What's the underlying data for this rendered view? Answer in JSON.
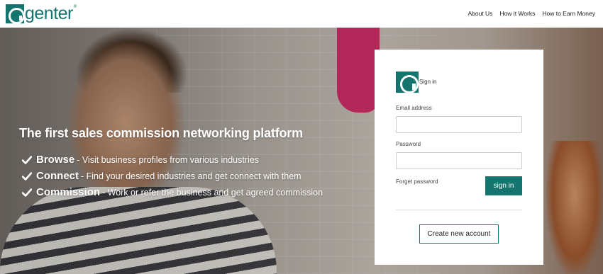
{
  "brand": {
    "name": "genter",
    "registered": "®",
    "color": "#14756f"
  },
  "nav": {
    "items": [
      "About Us",
      "How it Works",
      "How to Earn Money"
    ]
  },
  "hero": {
    "tagline": "The first sales commission networking platform",
    "features": [
      {
        "name": "Browse",
        "desc": "- Visit business profiles from various industries"
      },
      {
        "name": "Connect",
        "desc": "- Find your desired industries and get connect with them"
      },
      {
        "name": "Commission",
        "desc": "- Work or refer the business and get agreed commission"
      }
    ]
  },
  "signin": {
    "title": "Sign in",
    "email_label": "Email address",
    "email_value": "",
    "password_label": "Password",
    "password_value": "",
    "forgot_label": "Forget password",
    "submit_label": "sign in",
    "create_label": "Create new account"
  }
}
